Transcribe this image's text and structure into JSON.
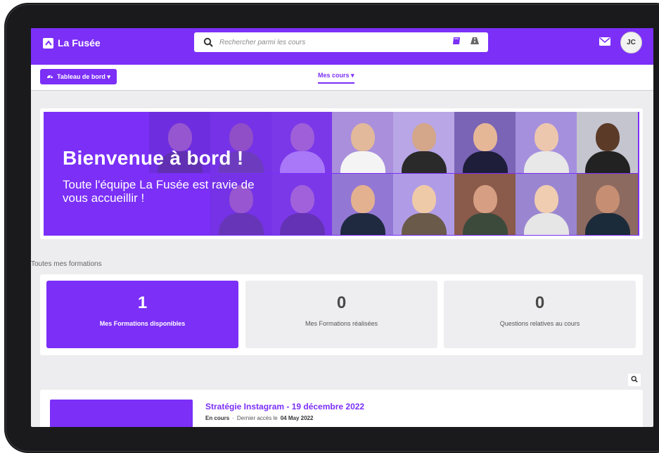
{
  "header": {
    "brand": "La Fusée",
    "search_placeholder": "Rechercher parmi les cours",
    "avatar_initials": "JC"
  },
  "subnav": {
    "dashboard_label": "Tableau de bord ▾",
    "courses_label": "Mes cours ▾"
  },
  "banner": {
    "title": "Bienvenue à bord !",
    "subtitle": "Toute l'équipe La Fusée est ravie de vous accueillir !"
  },
  "section": {
    "label": "Toutes mes formations"
  },
  "stats": [
    {
      "value": "1",
      "label": "Mes Formations disponibles"
    },
    {
      "value": "0",
      "label": "Mes Formations réalisées"
    },
    {
      "value": "0",
      "label": "Questions relatives au cours"
    }
  ],
  "course": {
    "title": "Stratégie Instagram - 19 décembre 2022",
    "status": "En cours",
    "separator": "·",
    "last_access_label": "Dernier accès le",
    "last_access_date": "04 May 2022"
  },
  "colors": {
    "brand": "#7b2ff7",
    "background": "#edecee"
  }
}
